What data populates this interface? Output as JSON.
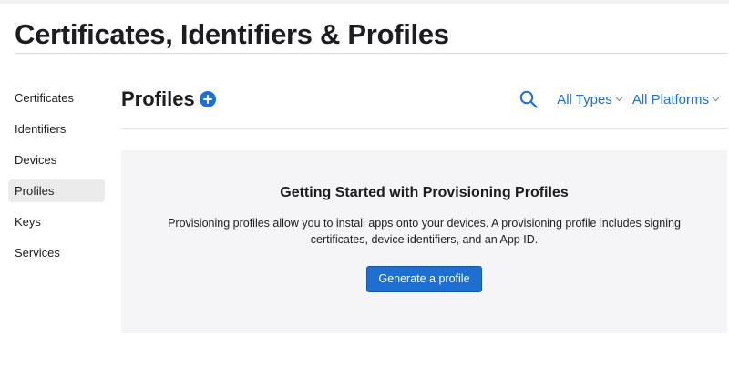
{
  "page": {
    "title": "Certificates, Identifiers & Profiles"
  },
  "sidebar": {
    "items": [
      {
        "label": "Certificates",
        "active": false
      },
      {
        "label": "Identifiers",
        "active": false
      },
      {
        "label": "Devices",
        "active": false
      },
      {
        "label": "Profiles",
        "active": true
      },
      {
        "label": "Keys",
        "active": false
      },
      {
        "label": "Services",
        "active": false
      }
    ]
  },
  "section": {
    "title": "Profiles",
    "add_icon": "plus-circle-icon"
  },
  "filters": {
    "search_icon": "search-icon",
    "types_label": "All Types",
    "platforms_label": "All Platforms"
  },
  "empty_state": {
    "title": "Getting Started with Provisioning Profiles",
    "description": "Provisioning profiles allow you to install apps onto your devices. A provisioning profile includes signing certificates, device identifiers, and an App ID.",
    "button_label": "Generate a profile"
  },
  "colors": {
    "accent": "#1f6fd1",
    "active_item_bg": "#ebebeb",
    "card_bg": "#f5f5f7",
    "text": "#1d1d1f"
  }
}
